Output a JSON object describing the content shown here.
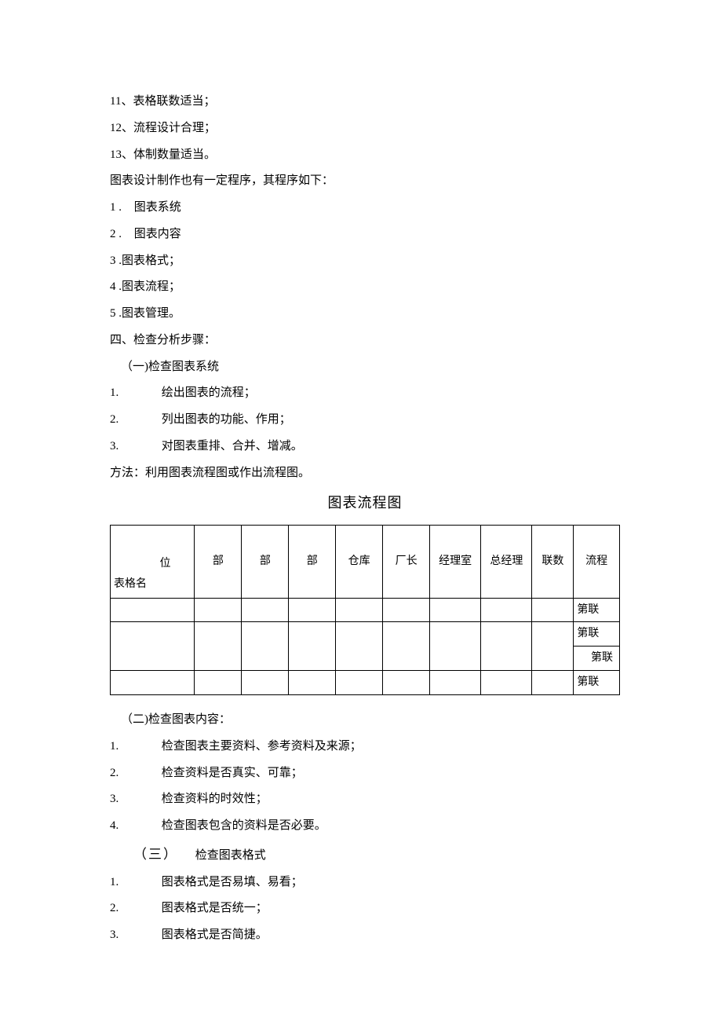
{
  "top_list": {
    "i11": "11、表格联数适当；",
    "i12": "12、流程设计合理；",
    "i13": "13、体制数量适当。"
  },
  "design_intro": "图表设计制作也有一定程序，其程序如下：",
  "design_items": {
    "n1": "1   .",
    "t1": "图表系统",
    "n2": "2   .",
    "t2": "图表内容",
    "n3": "3   .图表格式；",
    "n4": "4   .图表流程；",
    "n5": "5   .图表管理。"
  },
  "section4": "四、检查分析步骤：",
  "sub1_title": "（一)检查图表系统",
  "sub1": {
    "n1": "1.",
    "t1": "绘出图表的流程；",
    "n2": "2.",
    "t2": "列出图表的功能、作用；",
    "n3": "3.",
    "t3": "对图表重排、合并、增减。"
  },
  "method": "方法：利用图表流程图或作出流程图。",
  "table_title": "图表流程图",
  "table_header": {
    "corner_wei": "位",
    "corner_name": "表格名",
    "c1": "部",
    "c2": "部",
    "c3": "部",
    "c4": "仓库",
    "c5": "厂长",
    "c6": "经理室",
    "c7": "总经理",
    "c8": "联数",
    "c9": "流程"
  },
  "table_rows": {
    "r1": "第联",
    "r2": "第联",
    "r3": "第联",
    "r4": "第联"
  },
  "sub2_title": "（二)检查图表内容：",
  "sub2": {
    "n1": "1.",
    "t1": "检查图表主要资料、参考资料及来源；",
    "n2": "2.",
    "t2": "检查资料是否真实、可靠；",
    "n3": "3.",
    "t3": "检查资料的时效性；",
    "n4": "4.",
    "t4": "检查图表包含的资料是否必要。"
  },
  "sub3_num": "（三）",
  "sub3_title": "检查图表格式",
  "sub3": {
    "n1": "1.",
    "t1": "图表格式是否易填、易看；",
    "n2": "2.",
    "t2": "图表格式是否统一；",
    "n3": "3.",
    "t3": "图表格式是否简捷。"
  }
}
